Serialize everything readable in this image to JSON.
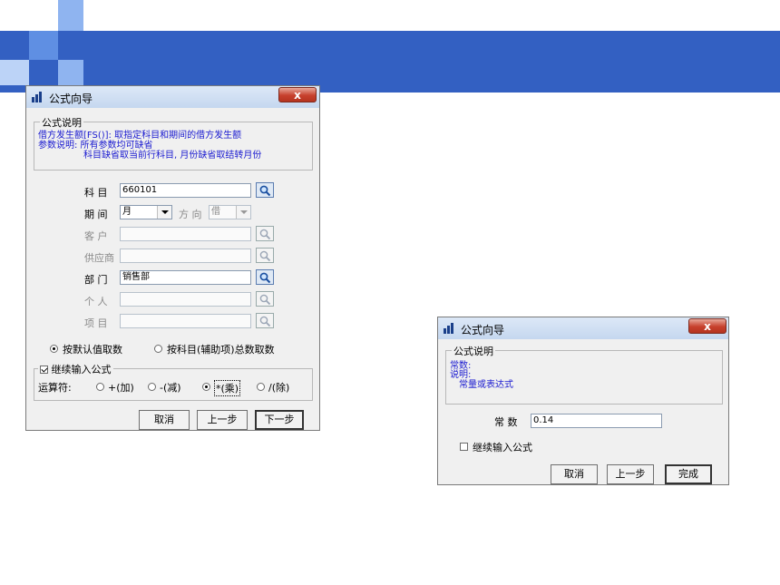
{
  "colors": {
    "banner": "#3360c2",
    "square_light": "#8fb4f0",
    "square_mid": "#5f8fe3",
    "link_blue": "#1a1ad0"
  },
  "dialog1": {
    "title": "公式向导",
    "close": "x",
    "description_group": "公式说明",
    "desc_line1": "借方发生额[FS()]: 取指定科目和期间的借方发生额",
    "desc_line2": "参数说明: 所有参数均可缺省",
    "desc_line3": "科目缺省取当前行科目, 月份缺省取结转月份",
    "fields": {
      "subject_label": "科 目",
      "subject_value": "660101",
      "period_label": "期 间",
      "period_value": "月",
      "direction_label": "方 向",
      "direction_value": "借",
      "customer_label": "客 户",
      "customer_value": "",
      "supplier_label": "供应商",
      "supplier_value": "",
      "dept_label": "部 门",
      "dept_value": "销售部",
      "person_label": "个 人",
      "person_value": "",
      "item_label": "项 目",
      "item_value": ""
    },
    "radio_default": "按默认值取数",
    "radio_subject": "按科目(辅助项)总数取数",
    "continue_label": "继续输入公式",
    "operator_label": "运算符:",
    "op_add": "+(加)",
    "op_sub": "-(减)",
    "op_mul": "*(乘)",
    "op_div": "/(除)",
    "btn_cancel": "取消",
    "btn_prev": "上一步",
    "btn_next": "下一步"
  },
  "dialog2": {
    "title": "公式向导",
    "close": "x",
    "description_group": "公式说明",
    "desc_line1": "常数:",
    "desc_line2": "说明:",
    "desc_line3": "常量或表达式",
    "const_label": "常 数",
    "const_value": "0.14",
    "continue_label": "继续输入公式",
    "btn_cancel": "取消",
    "btn_prev": "上一步",
    "btn_finish": "完成"
  }
}
